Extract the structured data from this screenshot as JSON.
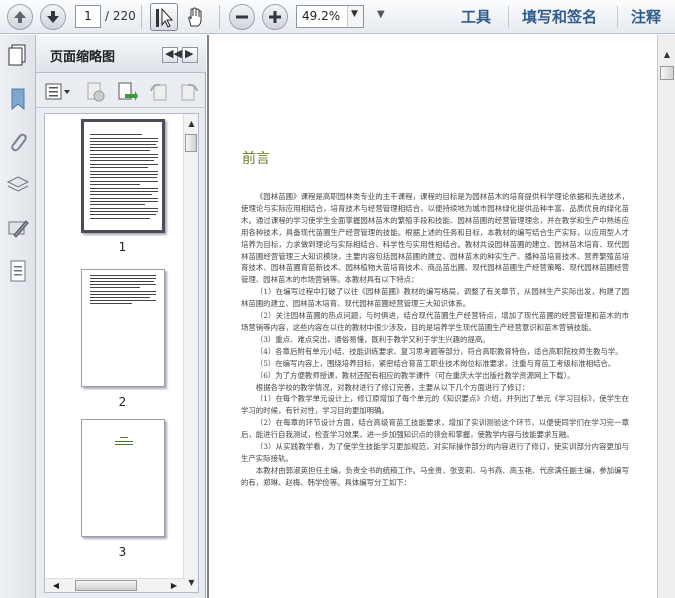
{
  "toolbar": {
    "page_current": "1",
    "page_total": "/ 220",
    "zoom": "49.2%",
    "links": [
      "工具",
      "填写和签名",
      "注释"
    ]
  },
  "sidebar": {
    "title": "页面缩略图",
    "thumbnails": [
      {
        "label": "1",
        "selected": true
      },
      {
        "label": "2",
        "selected": false
      },
      {
        "label": "3",
        "selected": false
      }
    ]
  },
  "document": {
    "heading": "前言",
    "paragraphs": [
      "《园林苗圃》课程是高职园林类专业的主干课程，课程的目标是为园林苗木的培育提供科学理论依据和先进技术，使理论与实际应用相结合，培育技术与经营管理相结合，以便持续地为城市园林绿化提供品种丰富、品质优良的绿化苗木。通过课程的学习使学生全面掌握园林苗木的繁殖手段和技能、园林苗圃的经营管理理念，并在教学和生产中熟练应用各种技术，具备现代苗圃生产经营管理的技能。根据上述的任务和目标，本教材的编写结合生产实际，以应用型人才培养为目标，力求做到理论与实际相结合、科学性与实用性相结合。教材共设园林苗圃的建立、园林苗木培育、现代园林苗圃经营管理三大知识模块，主要内容包括园林苗圃的建立、园林苗木的种实生产、播种苗培育技术、营养繁殖苗培育技术、园林苗圃育苗新技术、园林植物大苗培育技术、商品苗出圃、现代园林苗圃生产经营策略、现代园林苗圃经营管理、园林苗木的市场营销等。本教材具有以下特点：",
      "（1）在编写过程中打破了以往《园林苗圃》教材的编写格局，调整了有关章节，从园林生产实际出发，构建了园林苗圃的建立、园林苗木培育、现代园林苗圃经营管理三大知识体系。",
      "（2）关注园林苗圃的热点问题，与时俱进，结合现代苗圃生产经营特点，增加了现代苗圃的经营管理和苗木的市场营销等内容，这些内容在以往的教材中很少涉及，目的是培养学生现代苗圃生产经营意识和苗木营销技能。",
      "（3）重点、难点突出，通俗易懂，既利于教学又利于学生兴趣的提高。",
      "（4）各章后附有单元小结、技能训练要求、复习思考题等部分，符合高职教育特色，适合高职院校师生教与学。",
      "（5）在编写内容上，围绕培养目标，紧密结合育苗工职业技术岗位标准要求，注重与育苗工考级标准相结合。",
      "（6）为了方便教师授课，教材还配有相应的教学课件（可在重庆大学出版社教学资源网上下载）。",
      "根据各学校的教学情况，对教材进行了修订完善，主要从以下几个方面进行了修订：",
      "（1）在每个教学单元设计上，修订原增加了每个单元的《知识要点》介绍，并列出了单元《学习目标》，使学生在学习的时候，有针对性，学习目的更加明确。",
      "（2）在每章的环节设计方面，结合高级育苗工技能要求，增加了实训测验这个环节，以便使同学们在学习完一章后，能进行自我测试，检查学习效果，进一步加强知识点的领会和掌握，使教学内容与技能要求互融。",
      "（3）从实践教学看，为了使学生技能学习更加规范，对实际操作部分的内容进行了修订，使实训部分内容更加与生产实际接轨。",
      "本教材由郭淑英担任主编，负责全书的统稿工作。马金贵、张变莉、马书燕、高玉艳、代彦满任副主编，参加编写的有，郑琳、赵梅、韩学俭等。具体编写分工如下："
    ]
  }
}
